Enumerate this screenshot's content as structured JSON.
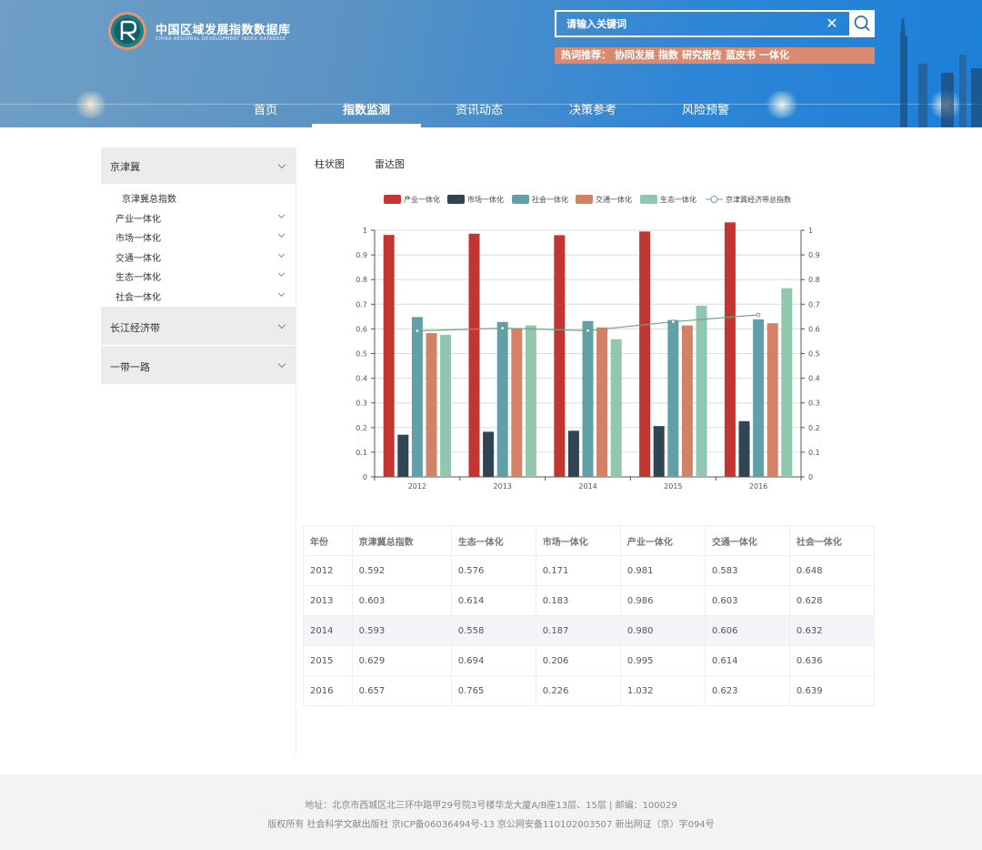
{
  "header": {
    "brand_cn": "中国区域发展指数数据库",
    "brand_en": "CHINA REGIONAL DEVELOPMENT INDEX DATABASE",
    "search_placeholder": "请输入关键词",
    "hot_label": "热词推荐：",
    "hot_words": [
      "协同发展",
      "指数",
      "研究报告",
      "蓝皮书",
      "一体化"
    ]
  },
  "nav": {
    "items": [
      "首页",
      "指数监测",
      "资讯动态",
      "决策参考",
      "风险预警"
    ],
    "active": "指数监测"
  },
  "sidebar": {
    "groups": [
      {
        "label": "京津冀",
        "expanded": true,
        "children": [
          "京津冀总指数",
          "产业一体化",
          "市场一体化",
          "交通一体化",
          "生态一体化",
          "社会一体化"
        ]
      },
      {
        "label": "长江经济带",
        "expanded": false
      },
      {
        "label": "一带一路",
        "expanded": false
      }
    ]
  },
  "tabs": [
    "柱状图",
    "雷达图"
  ],
  "chart_data": {
    "type": "bar",
    "categories": [
      "2012",
      "2013",
      "2014",
      "2015",
      "2016"
    ],
    "series": [
      {
        "name": "产业一体化",
        "type": "bar",
        "color": "#c23531",
        "values": [
          0.981,
          0.986,
          0.98,
          0.995,
          1.032
        ]
      },
      {
        "name": "市场一体化",
        "type": "bar",
        "color": "#2f4554",
        "values": [
          0.171,
          0.183,
          0.187,
          0.206,
          0.226
        ]
      },
      {
        "name": "社会一体化",
        "type": "bar",
        "color": "#61a0a8",
        "values": [
          0.648,
          0.628,
          0.632,
          0.636,
          0.639
        ]
      },
      {
        "name": "交通一体化",
        "type": "bar",
        "color": "#d48265",
        "values": [
          0.583,
          0.603,
          0.606,
          0.614,
          0.623
        ]
      },
      {
        "name": "生态一体化",
        "type": "bar",
        "color": "#91c7ae",
        "values": [
          0.576,
          0.614,
          0.558,
          0.694,
          0.765
        ]
      },
      {
        "name": "京津冀经济带总指数",
        "type": "line",
        "color": "#749f83",
        "values": [
          0.592,
          0.603,
          0.593,
          0.629,
          0.657
        ]
      }
    ],
    "ylim": [
      0,
      1
    ],
    "yticks": [
      "0",
      "0.1",
      "0.2",
      "0.3",
      "0.4",
      "0.5",
      "0.6",
      "0.7",
      "0.8",
      "0.9",
      "1"
    ],
    "legend_position": "top",
    "grid": true,
    "secondary_axis": true
  },
  "table": {
    "headers": [
      "年份",
      "京津冀总指数",
      "生态一体化",
      "市场一体化",
      "产业一体化",
      "交通一体化",
      "社会一体化"
    ],
    "rows": [
      [
        "2012",
        "0.592",
        "0.576",
        "0.171",
        "0.981",
        "0.583",
        "0.648"
      ],
      [
        "2013",
        "0.603",
        "0.614",
        "0.183",
        "0.986",
        "0.603",
        "0.628"
      ],
      [
        "2014",
        "0.593",
        "0.558",
        "0.187",
        "0.980",
        "0.606",
        "0.632"
      ],
      [
        "2015",
        "0.629",
        "0.694",
        "0.206",
        "0.995",
        "0.614",
        "0.636"
      ],
      [
        "2016",
        "0.657",
        "0.765",
        "0.226",
        "1.032",
        "0.623",
        "0.639"
      ]
    ],
    "highlighted_row": "2014"
  },
  "footer": {
    "line1": "地址：北京市西城区北三环中路甲29号院3号楼华龙大厦A/B座13层、15层 | 邮编：100029",
    "line2": "版权所有 社会科学文献出版社 京ICP备06036494号-13 京公网安备11010200350​7 新出网证（京）字094号"
  }
}
